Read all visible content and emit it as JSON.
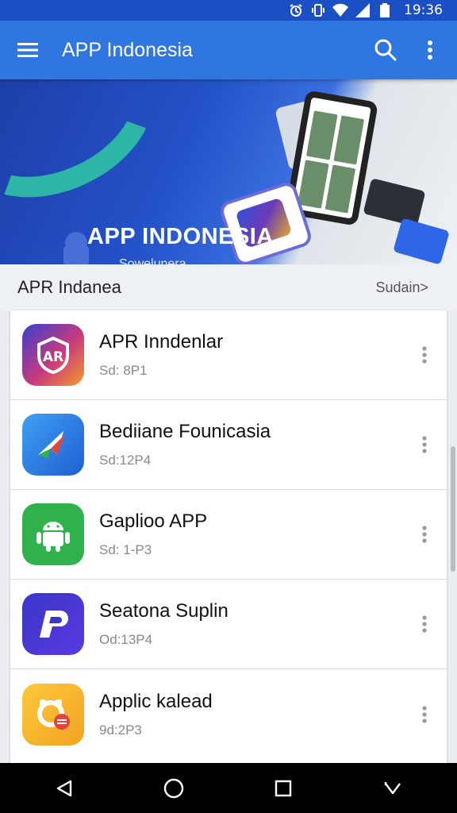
{
  "status_bar": {
    "time": "19:36",
    "icons": [
      "alarm-icon",
      "vibrate-icon",
      "wifi-icon",
      "signal-icon",
      "battery-icon"
    ]
  },
  "app_bar": {
    "title": "APP Indonesia",
    "icons": [
      "menu-icon",
      "search-icon",
      "more-vert-icon"
    ]
  },
  "banner": {
    "title": "APP INDONESIA",
    "subtitle": "Sowelunera"
  },
  "section": {
    "title": "APR Indanea",
    "more_label": "Sudain>"
  },
  "apps": [
    {
      "name": "APR Inndenlar",
      "meta": "Sd: 8P1"
    },
    {
      "name": "Bediiane Founicasia",
      "meta": "Sd:12P4"
    },
    {
      "name": "Gaplioo APP",
      "meta": "Sd: 1-P3"
    },
    {
      "name": "Seatona Suplin",
      "meta": "Od:13P4"
    },
    {
      "name": "Applic kalead",
      "meta": "9d:2P3"
    }
  ],
  "colors": {
    "status_bar": "#1b4fc4",
    "app_bar": "#2f76e0",
    "icon_1": "#e2453f",
    "icon_2": "#2f7de6",
    "icon_3": "#2fb24c",
    "icon_4": "#3a35c9",
    "icon_5": "#f5b326"
  },
  "nav_bar": {
    "icons": [
      "back-icon",
      "home-icon",
      "recents-icon",
      "keyboard-down-icon"
    ]
  }
}
